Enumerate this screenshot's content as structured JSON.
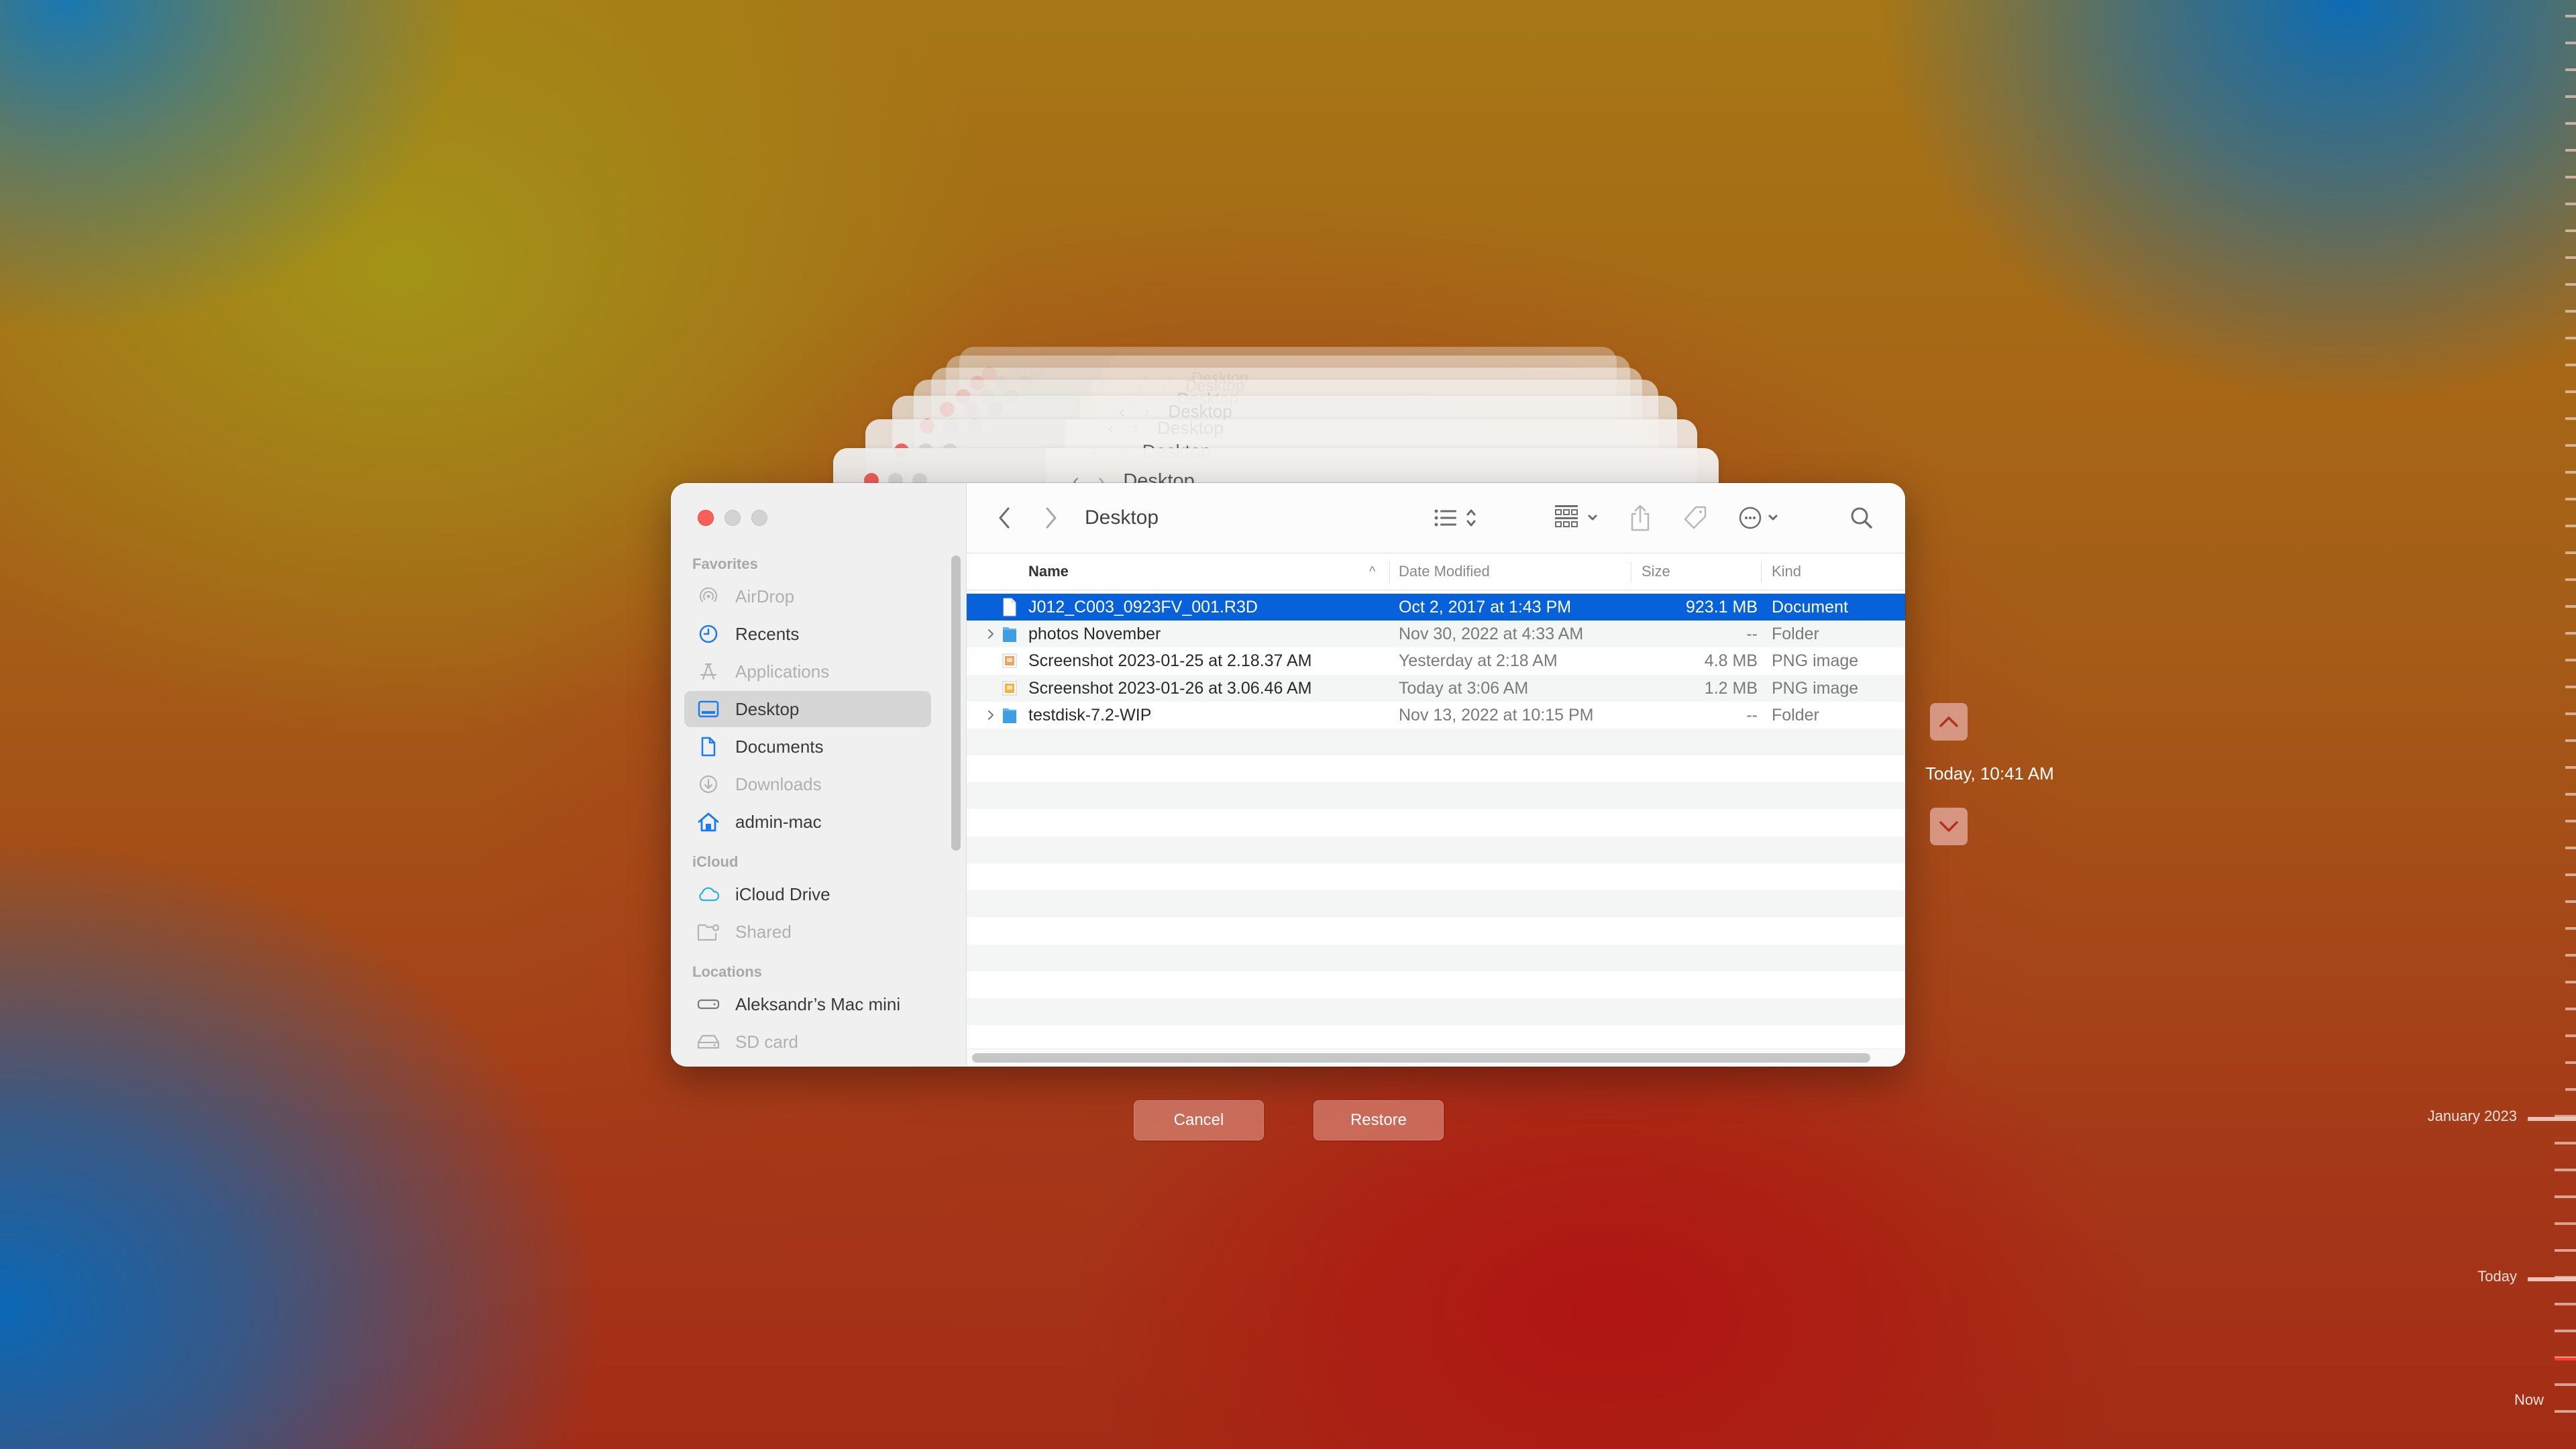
{
  "window": {
    "title": "Desktop",
    "toolbar": {
      "back_icon": "chevron-left-icon",
      "forward_icon": "chevron-right-icon",
      "view_icon": "list-view-icon",
      "group_icon": "group-grid-icon",
      "share_icon": "share-icon",
      "tag_icon": "tag-icon",
      "action_icon": "ellipsis-circle-icon",
      "search_icon": "search-icon"
    },
    "sidebar": {
      "sections": [
        {
          "title": "Favorites",
          "items": [
            {
              "label": "AirDrop",
              "icon": "airdrop-icon",
              "dim": true
            },
            {
              "label": "Recents",
              "icon": "clock-icon",
              "dim": false
            },
            {
              "label": "Applications",
              "icon": "applications-icon",
              "dim": true
            },
            {
              "label": "Desktop",
              "icon": "desktop-icon",
              "dim": false,
              "selected": true
            },
            {
              "label": "Documents",
              "icon": "document-icon",
              "dim": false
            },
            {
              "label": "Downloads",
              "icon": "download-icon",
              "dim": true
            },
            {
              "label": "admin-mac",
              "icon": "home-icon",
              "dim": false
            }
          ]
        },
        {
          "title": "iCloud",
          "items": [
            {
              "label": "iCloud Drive",
              "icon": "cloud-icon",
              "dim": false
            },
            {
              "label": "Shared",
              "icon": "shared-folder-icon",
              "dim": true
            }
          ]
        },
        {
          "title": "Locations",
          "items": [
            {
              "label": "Aleksandr’s Mac mini",
              "icon": "computer-icon",
              "dim": false
            },
            {
              "label": "SD card",
              "icon": "drive-icon",
              "dim": true
            }
          ]
        }
      ]
    },
    "columns": {
      "name": "Name",
      "date": "Date Modified",
      "size": "Size",
      "kind": "Kind",
      "sort_indicator": "^"
    },
    "files": [
      {
        "name": "J012_C003_0923FV_001.R3D",
        "date": "Oct 2, 2017 at 1:43 PM",
        "size": "923.1 MB",
        "kind": "Document",
        "type": "document",
        "expandable": false,
        "selected": true
      },
      {
        "name": "photos November",
        "date": "Nov 30, 2022 at 4:33 AM",
        "size": "--",
        "kind": "Folder",
        "type": "folder",
        "expandable": true,
        "selected": false
      },
      {
        "name": "Screenshot 2023-01-25 at 2.18.37 AM",
        "date": "Yesterday at 2:18 AM",
        "size": "4.8 MB",
        "kind": "PNG image",
        "type": "image",
        "expandable": false,
        "selected": false
      },
      {
        "name": "Screenshot 2023-01-26 at 3.06.46 AM",
        "date": "Today at 3:06 AM",
        "size": "1.2 MB",
        "kind": "PNG image",
        "type": "image",
        "expandable": false,
        "selected": false
      },
      {
        "name": "testdisk-7.2-WIP",
        "date": "Nov 13, 2022 at 10:15 PM",
        "size": "--",
        "kind": "Folder",
        "type": "folder",
        "expandable": true,
        "selected": false
      }
    ]
  },
  "ghost_windows": {
    "title": "Desktop",
    "count": 7
  },
  "time_machine": {
    "cancel_label": "Cancel",
    "restore_label": "Restore",
    "snapshot_label": "Today, 10:41 AM",
    "up_icon": "chevron-up-icon",
    "down_icon": "chevron-down-icon",
    "timeline": {
      "labels": [
        "January 2023",
        "Today",
        "Now"
      ]
    }
  },
  "colors": {
    "selection": "#0661db",
    "accent_icon": "#1a7cf0",
    "close_button": "#fe5f57",
    "timeline_now": "#ff3a30"
  }
}
